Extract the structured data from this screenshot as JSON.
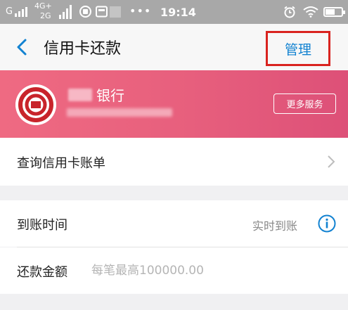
{
  "status_bar": {
    "signal_g": "G",
    "network_top": "4G+",
    "network_bottom": "2G",
    "time": "19:14",
    "battery_level": 0.6
  },
  "nav": {
    "title": "信用卡还款",
    "manage_label": "管理"
  },
  "bank": {
    "name_suffix": "银行",
    "more_services_label": "更多服务"
  },
  "query_row": {
    "label": "查询信用卡账单"
  },
  "arrival_row": {
    "label": "到账时间",
    "value": "实时到账"
  },
  "amount_row": {
    "label": "还款金额",
    "placeholder": "每笔最高100000.00"
  },
  "colors": {
    "accent_blue": "#1282d1",
    "highlight_red": "#d9231f",
    "banner_pink": "#e75f7d",
    "bank_logo_red": "#c8242b"
  }
}
